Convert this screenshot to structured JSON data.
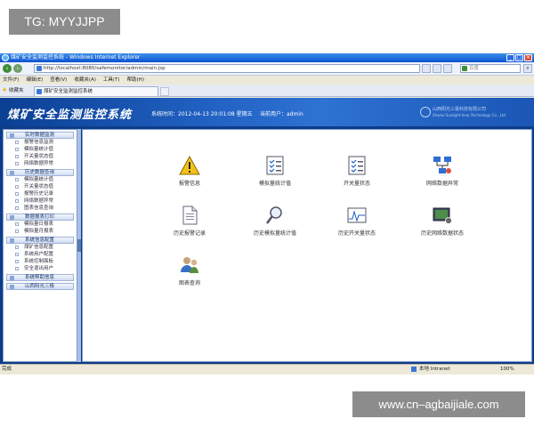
{
  "watermark_top": "TG: MYYJJPP",
  "watermark_bottom": "www.cn–agbaijiale.com",
  "browser": {
    "title": "煤矿安全监测监控系统 - Windows Internet Explorer",
    "address": "http://localhost:8080/safemonitor/admin/main.jsp",
    "search_placeholder": "百度",
    "menu": [
      "文件(F)",
      "编辑(E)",
      "查看(V)",
      "收藏夹(A)",
      "工具(T)",
      "帮助(H)"
    ],
    "favorites_label": "收藏夹",
    "tab_label": "煤矿安全监测监控系统",
    "status_done": "完成",
    "status_zone": "本地 Intranet",
    "status_zoom": "100%"
  },
  "app": {
    "title": "煤矿安全监测监控系统",
    "sys_time": "系统时间：2012-04-13 20:01:08 星期五",
    "current_user": "当前用户：admin",
    "company_cn": "山西阳光三极科技有限公司",
    "company_en": "Shanxi Sunlight-Inno Technology Co., Ltd"
  },
  "sidebar": {
    "groups": [
      {
        "head": "实时数据监测",
        "items": [
          "报警信息监测",
          "模拟量统计值",
          "开关量状态值",
          "网络数据异常"
        ]
      },
      {
        "head": "历史数据查询",
        "items": [
          "模拟量统计值",
          "开关量状态值",
          "报警历史记录",
          "网络数据异常",
          "图表信息查询"
        ]
      },
      {
        "head": "数据报表打印",
        "items": [
          "模拟量日报表",
          "模拟量月报表"
        ]
      },
      {
        "head": "系统信息配置",
        "items": [
          "煤矿信息配置",
          "系统用户配置",
          "系统控制面板",
          "安全退出用户"
        ]
      },
      {
        "head": "系统帮助信息",
        "items": []
      },
      {
        "head": "山西阳光三极",
        "items": []
      }
    ]
  },
  "tiles": [
    {
      "label": "报警信息",
      "icon": "warning-icon"
    },
    {
      "label": "模拟量统计值",
      "icon": "checklist-icon"
    },
    {
      "label": "开关量状态",
      "icon": "checklist-icon"
    },
    {
      "label": "网络数据异常",
      "icon": "network-icon"
    },
    {
      "label": "历史报警记录",
      "icon": "document-icon"
    },
    {
      "label": "历史模拟量统计值",
      "icon": "magnifier-icon"
    },
    {
      "label": "历史开关量状态",
      "icon": "waveform-icon"
    },
    {
      "label": "历史网络数据状态",
      "icon": "monitor-icon"
    },
    {
      "label": "图表查询",
      "icon": "users-icon"
    }
  ],
  "colors": {
    "header_blue": "#2262c4",
    "app_bg": "#0d3c89",
    "warning_yellow": "#f2c21b"
  }
}
